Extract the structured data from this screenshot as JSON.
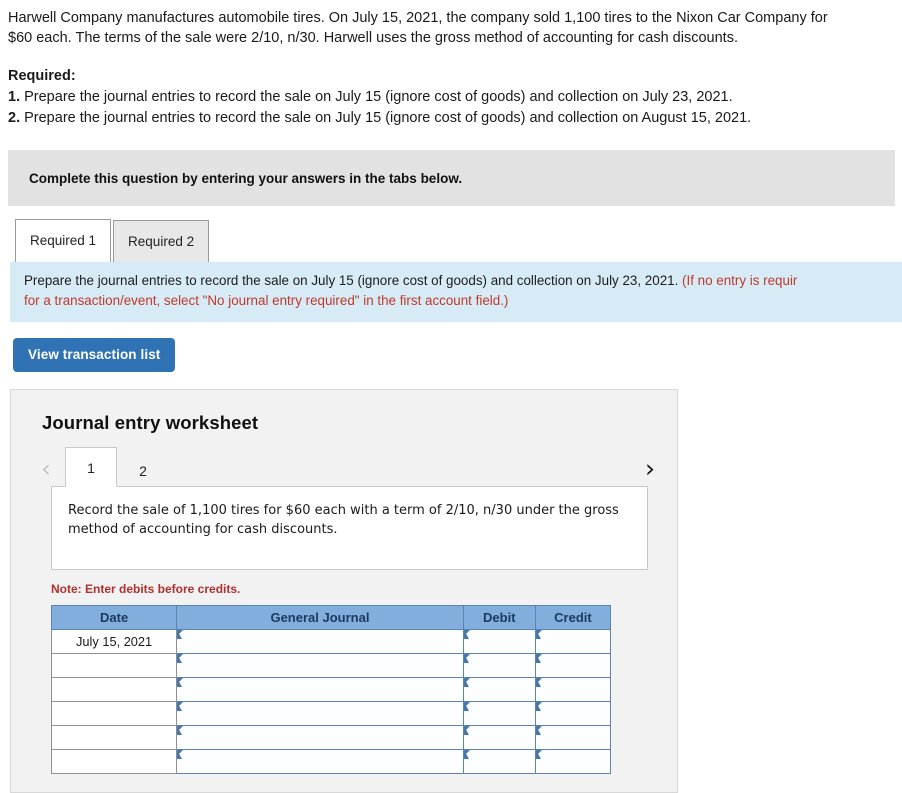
{
  "problem": {
    "paragraph_1": "Harwell Company manufactures automobile tires. On July 15, 2021, the company sold 1,100 tires to the Nixon Car Company for",
    "paragraph_2": "$60 each. The terms of the sale were 2/10, n/30. Harwell uses the gross method of accounting for cash discounts.",
    "required_heading": "Required:",
    "requirements": [
      {
        "number": "1.",
        "text": " Prepare the journal entries to record the sale on July 15 (ignore cost of goods) and collection on July 23, 2021."
      },
      {
        "number": "2.",
        "text": " Prepare the journal entries to record the sale on July 15 (ignore cost of goods) and collection on August 15, 2021."
      }
    ]
  },
  "complete_bar": {
    "text": "Complete this question by entering your answers in the tabs below."
  },
  "tabs": [
    {
      "label": "Required 1",
      "active": true
    },
    {
      "label": "Required 2",
      "active": false
    }
  ],
  "info_panel": {
    "line_1_main": "Prepare the journal entries to record the sale on July 15 (ignore cost of goods) and collection on July 23, 2021. ",
    "line_1_hint": "(If no entry is requir",
    "line_2_hint": "for a transaction/event, select \"No journal entry required\" in the first account field.)"
  },
  "toolbar": {
    "view_transaction_list_label": "View transaction list"
  },
  "worksheet": {
    "title": "Journal entry worksheet",
    "pager": {
      "prev_icon": "‹",
      "next_icon": "›",
      "pages": [
        {
          "label": "1",
          "active": true
        },
        {
          "label": "2",
          "active": false
        }
      ]
    },
    "description": "Record the sale of 1,100 tires for $60 each with a term of 2/10, n/30 under the gross method of accounting for cash discounts.",
    "note": "Note: Enter debits before credits.",
    "table": {
      "headers": [
        "Date",
        "General Journal",
        "Debit",
        "Credit"
      ],
      "rows": [
        {
          "date": "July 15, 2021",
          "general_journal": "",
          "debit": "",
          "credit": ""
        },
        {
          "date": "",
          "general_journal": "",
          "debit": "",
          "credit": ""
        },
        {
          "date": "",
          "general_journal": "",
          "debit": "",
          "credit": ""
        },
        {
          "date": "",
          "general_journal": "",
          "debit": "",
          "credit": ""
        },
        {
          "date": "",
          "general_journal": "",
          "debit": "",
          "credit": ""
        },
        {
          "date": "",
          "general_journal": "",
          "debit": "",
          "credit": ""
        }
      ]
    }
  },
  "colors": {
    "primary_button": "#3073b4",
    "table_header": "#82aedd",
    "info_panel_bg": "#d7ebf7",
    "hint_text": "#c0392b",
    "note_text": "#b03030"
  }
}
